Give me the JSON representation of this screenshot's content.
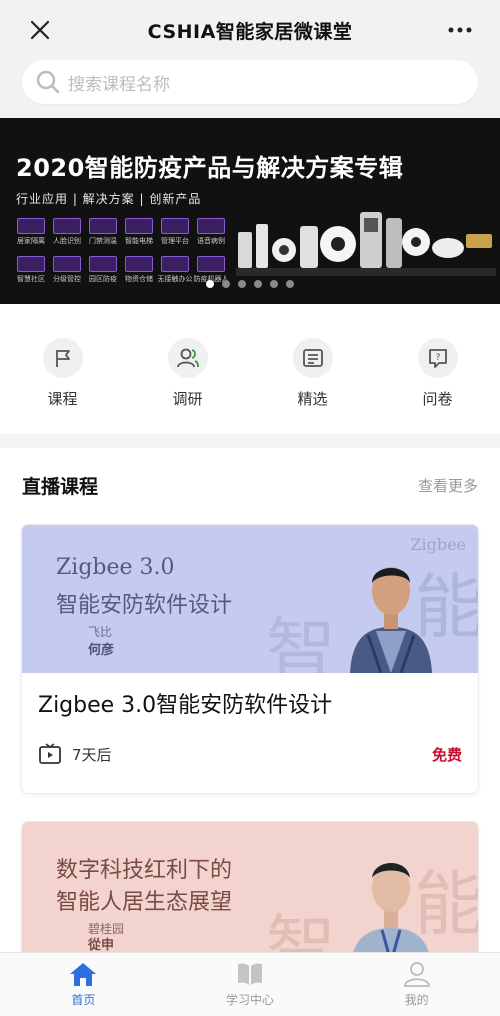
{
  "topbar": {
    "title": "CSHIA智能家居微课堂"
  },
  "search": {
    "placeholder": "搜索课程名称"
  },
  "banner": {
    "title": "2020智能防疫产品与解决方案专辑",
    "subtitle": "行业应用 | 解决方案 | 创新产品",
    "grid_labels": [
      "居家隔离",
      "人脸识别",
      "门禁测温",
      "智能电梯",
      "管理平台",
      "语音病例",
      "智慧社区",
      "分级管控",
      "园区防疫",
      "物资仓储",
      "无接触办公",
      "防疫机器人"
    ],
    "dot_count": 6,
    "active_dot": 1
  },
  "nav": [
    {
      "label": "课程",
      "icon": "flag-icon"
    },
    {
      "label": "调研",
      "icon": "users-icon"
    },
    {
      "label": "精选",
      "icon": "list-card-icon"
    },
    {
      "label": "问卷",
      "icon": "question-bubble-icon"
    }
  ],
  "section": {
    "title": "直播课程",
    "more": "查看更多"
  },
  "courses": [
    {
      "cover_line1": "Zigbee 3.0",
      "cover_line2": "智能安防软件设计",
      "cover_org": "飞比",
      "cover_person": "何彦",
      "watermark_small": "Zigbee",
      "watermark_big": "能",
      "watermark_big2": "智",
      "title": "Zigbee 3.0智能安防软件设计",
      "time": "7天后",
      "price": "免费"
    },
    {
      "cover_line1": "数字科技红利下的",
      "cover_line2": "智能人居生态展望",
      "cover_org": "碧桂园",
      "cover_person": "從申",
      "watermark_big": "能",
      "watermark_big2": "智"
    }
  ],
  "tabbar": [
    {
      "label": "首页",
      "icon": "home-icon",
      "active": true
    },
    {
      "label": "学习中心",
      "icon": "book-icon",
      "active": false
    },
    {
      "label": "我的",
      "icon": "person-icon",
      "active": false
    }
  ],
  "colors": {
    "accent": "#2f6ee0",
    "price": "#c8102e",
    "banner_bg": "#111111"
  }
}
